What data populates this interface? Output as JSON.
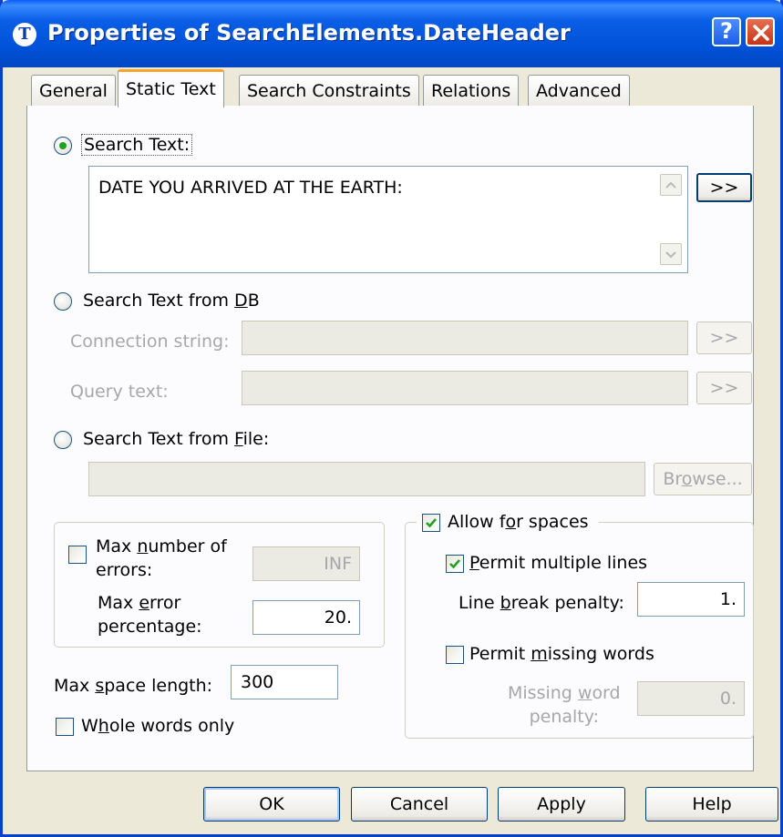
{
  "window": {
    "title": "Properties of SearchElements.DateHeader",
    "icon_letter": "T",
    "help_label": "?"
  },
  "tabs": [
    {
      "label": "General"
    },
    {
      "label": "Static Text"
    },
    {
      "label": "Search Constraints"
    },
    {
      "label": "Relations"
    },
    {
      "label": "Advanced"
    }
  ],
  "search_text": {
    "label": "Search Text:",
    "value": "DATE YOU ARRIVED AT THE EARTH:",
    "expand_label": ">>"
  },
  "search_db": {
    "label": "Search Text from DB",
    "connection_label": "Connection string:",
    "connection_value": "",
    "connection_expand": ">>",
    "query_label": "Query text:",
    "query_value": "",
    "query_expand": ">>"
  },
  "search_file": {
    "label": "Search Text from File:",
    "value": "",
    "browse_label": "Browse..."
  },
  "errors": {
    "max_errors_label_1": "Max number of",
    "max_errors_label_2": "errors:",
    "max_errors_value": "INF",
    "max_error_pct_label_1": "Max error",
    "max_error_pct_label_2": "percentage:",
    "max_error_pct_value": "20."
  },
  "spaces": {
    "allow_label": "Allow for spaces",
    "permit_multiple_label": "Permit multiple lines",
    "line_break_label": "Line break penalty:",
    "line_break_value": "1.",
    "permit_missing_label": "Permit missing words",
    "missing_penalty_label_1": "Missing word",
    "missing_penalty_label_2": "penalty:",
    "missing_penalty_value": "0."
  },
  "max_space": {
    "label": "Max space length:",
    "value": "300"
  },
  "whole_words": {
    "label": "Whole words only"
  },
  "buttons": {
    "ok": "OK",
    "cancel": "Cancel",
    "apply": "Apply",
    "help": "Help"
  },
  "colors": {
    "titlebar": "#0a5fe6",
    "dialog_bg": "#ece9d8",
    "tab_accent": "#f5a52d",
    "radio_dot": "#21a121",
    "check": "#21a121"
  }
}
